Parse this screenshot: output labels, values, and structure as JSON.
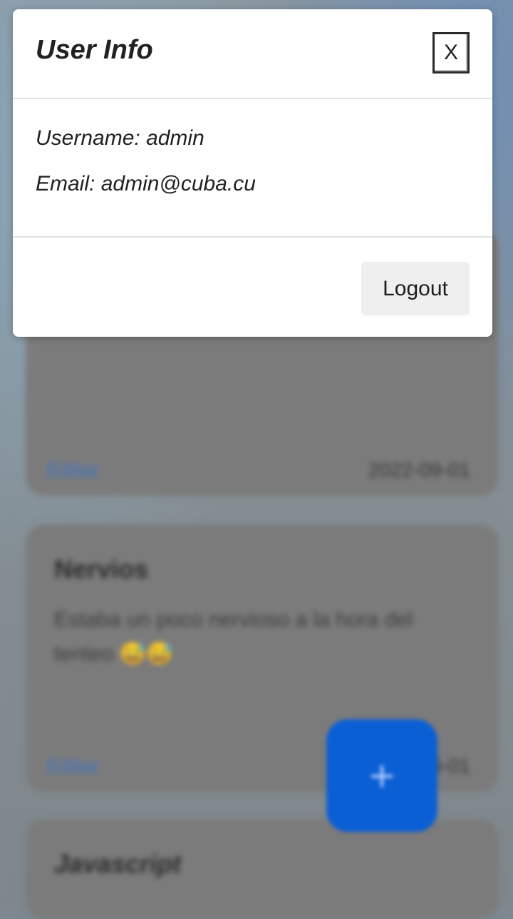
{
  "modal": {
    "title": "User Info",
    "close_label": "X",
    "username_label": "Username:",
    "username_value": "admin",
    "email_label": "Email:",
    "email_value": "admin@cuba.cu",
    "logout_label": "Logout"
  },
  "background": {
    "cards": [
      {
        "title": "",
        "body": "",
        "link": "Editar",
        "date": "2022-09-01"
      },
      {
        "title": "Nervios",
        "body": "Estaba un poco nervioso a la hora del tenteo 😅😅",
        "link": "Editar",
        "date": "2022-09-01"
      },
      {
        "title": "Javascript",
        "body": "",
        "link": "",
        "date": ""
      }
    ],
    "fab_label": "+"
  },
  "colors": {
    "accent": "#0b5fd4",
    "modal_bg": "#ffffff",
    "overlay": "#7d8890"
  }
}
